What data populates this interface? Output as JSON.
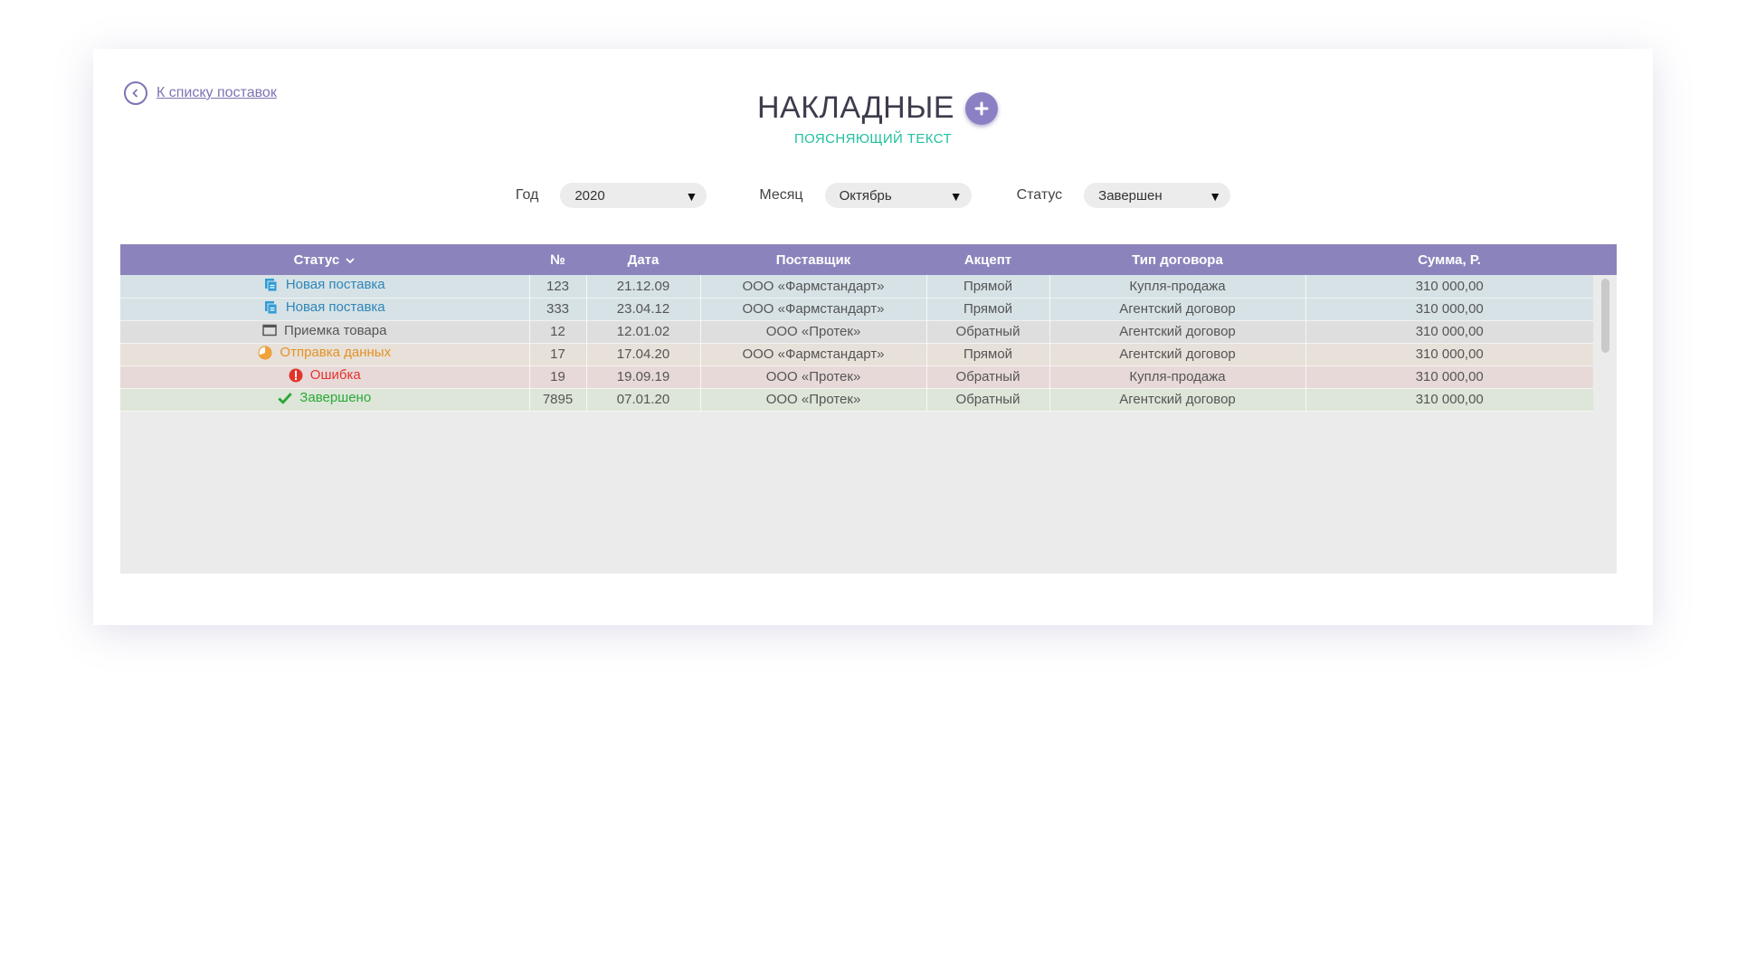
{
  "back_link": {
    "label": "К списку поставок"
  },
  "header": {
    "title": "НАКЛАДНЫЕ",
    "subtitle": "ПОЯСНЯЮЩИЙ ТЕКСТ"
  },
  "filters": {
    "year": {
      "label": "Год",
      "value": "2020"
    },
    "month": {
      "label": "Месяц",
      "value": "Октябрь"
    },
    "status": {
      "label": "Статус",
      "value": "Завершен"
    }
  },
  "table": {
    "columns": [
      "Статус",
      "№",
      "Дата",
      "Поставщик",
      "Акцепт",
      "Тип договора",
      "Сумма, Р."
    ],
    "rows": [
      {
        "status": "Новая поставка",
        "num": "123",
        "date": "21.12.09",
        "supplier": "ООО «Фармстандарт»",
        "accept": "Прямой",
        "contract": "Купля-продажа",
        "sum": "310 000,00"
      },
      {
        "status": "Новая поставка",
        "num": "333",
        "date": "23.04.12",
        "supplier": "ООО «Фармстандарт»",
        "accept": "Прямой",
        "contract": "Агентский договор",
        "sum": "310 000,00"
      },
      {
        "status": "Приемка товара",
        "num": "12",
        "date": "12.01.02",
        "supplier": "ООО «Протек»",
        "accept": "Обратный",
        "contract": "Агентский договор",
        "sum": "310 000,00"
      },
      {
        "status": "Отправка данных",
        "num": "17",
        "date": "17.04.20",
        "supplier": "ООО «Фармстандарт»",
        "accept": "Прямой",
        "contract": "Агентский договор",
        "sum": "310 000,00"
      },
      {
        "status": "Ошибка",
        "num": "19",
        "date": "19.09.19",
        "supplier": "ООО «Протек»",
        "accept": "Обратный",
        "contract": "Купля-продажа",
        "sum": "310 000,00"
      },
      {
        "status": "Завершено",
        "num": "7895",
        "date": "07.01.20",
        "supplier": "ООО «Протек»",
        "accept": "Обратный",
        "contract": "Агентский договор",
        "sum": "310 000,00"
      }
    ]
  },
  "icons": {
    "back": "chevron-left-icon",
    "add": "plus-icon",
    "sort": "chevron-down-icon",
    "status_new": "document-copy-icon",
    "status_receiving": "window-icon",
    "status_sending": "pie-progress-icon",
    "status_error": "exclamation-circle-icon",
    "status_done": "checkmark-icon"
  },
  "colors": {
    "accent": "#8b84bc",
    "subtitle": "#22c0a0",
    "row_new_bg": "#d6e2e6",
    "row_new_text": "#2f86b8",
    "row_receiving_bg": "#dedede",
    "row_sending_bg": "#e8e1d9",
    "row_sending_text": "#e39226",
    "row_error_bg": "#e8d9d9",
    "row_error_text": "#e2342c",
    "row_done_bg": "#dde6d8",
    "row_done_text": "#2aa839"
  }
}
